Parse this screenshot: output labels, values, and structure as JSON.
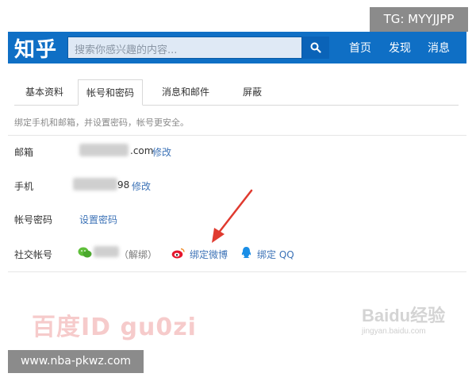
{
  "header": {
    "logo": "知乎",
    "search_placeholder": "搜索你感兴趣的内容...",
    "nav": [
      "首页",
      "发现",
      "消息"
    ]
  },
  "tabs": [
    "基本资料",
    "帐号和密码",
    "消息和邮件",
    "屏蔽"
  ],
  "active_tab_index": 1,
  "hint": "绑定手机和邮箱，并设置密码，帐号更安全。",
  "rows": {
    "email": {
      "label": "邮箱",
      "value_suffix": ".com",
      "action": "修改"
    },
    "phone": {
      "label": "手机",
      "value_suffix": "98",
      "action": "修改"
    },
    "password": {
      "label": "帐号密码",
      "action": "设置密码"
    },
    "social": {
      "label": "社交帐号",
      "wechat_unbind": "（解绑）",
      "weibo_bind": "绑定微博",
      "qq_bind": "绑定 QQ"
    }
  },
  "overlays": {
    "tg": "TG: MYYJJPP",
    "watermark": "百度ID gu0zi",
    "baidu": "Baidu经验",
    "baidu_sub": "jingyan.baidu.com",
    "site": "www.nba-pkwz.com"
  },
  "colors": {
    "brand_blue": "#0f6fc5",
    "link_blue": "#3d73b7",
    "arrow_red": "#e03a2f"
  }
}
